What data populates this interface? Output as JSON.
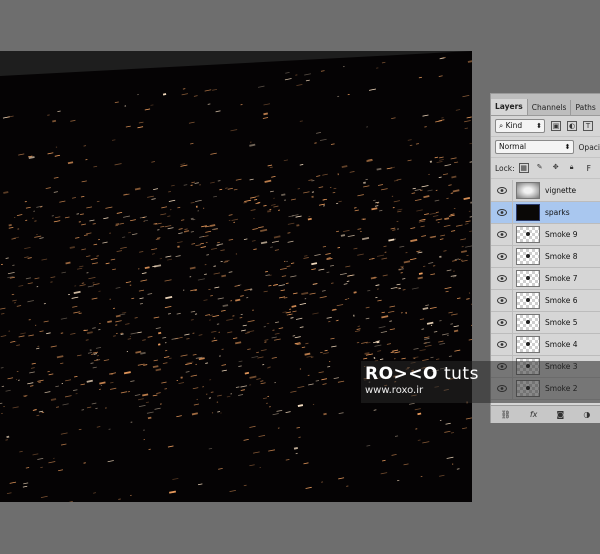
{
  "layers_panel": {
    "tabs": [
      "Layers",
      "Channels",
      "Paths"
    ],
    "filter_kind": "Kind",
    "blend_mode": "Normal",
    "opacity_label": "Opaci",
    "lock_label": "Lock:",
    "fill_label": "F",
    "layers": [
      {
        "name": "vignette",
        "thumb": "vignette",
        "selected": false
      },
      {
        "name": "sparks",
        "thumb": "dark",
        "selected": true
      },
      {
        "name": "Smoke 9",
        "thumb": "checker",
        "selected": false
      },
      {
        "name": "Smoke 8",
        "thumb": "checker",
        "selected": false
      },
      {
        "name": "Smoke 7",
        "thumb": "checker",
        "selected": false
      },
      {
        "name": "Smoke 6",
        "thumb": "checker",
        "selected": false
      },
      {
        "name": "Smoke 5",
        "thumb": "checker",
        "selected": false
      },
      {
        "name": "Smoke 4",
        "thumb": "checker",
        "selected": false
      },
      {
        "name": "Smoke 3",
        "thumb": "checker",
        "selected": false
      },
      {
        "name": "Smoke 2",
        "thumb": "checker",
        "selected": false
      }
    ],
    "bottom_icons": [
      "link-icon",
      "fx-icon",
      "mask-icon",
      "adjustment-icon"
    ],
    "bottom_fx": "fx"
  },
  "watermark": {
    "logo": "RO><O",
    "suffix": "tuts",
    "url": "www.roxo.ir"
  },
  "colors": {
    "canvas_bg": "#050304",
    "spark_warm": "#f0a060",
    "spark_white": "#ffe6c8",
    "selection": "#a9c7ef"
  }
}
